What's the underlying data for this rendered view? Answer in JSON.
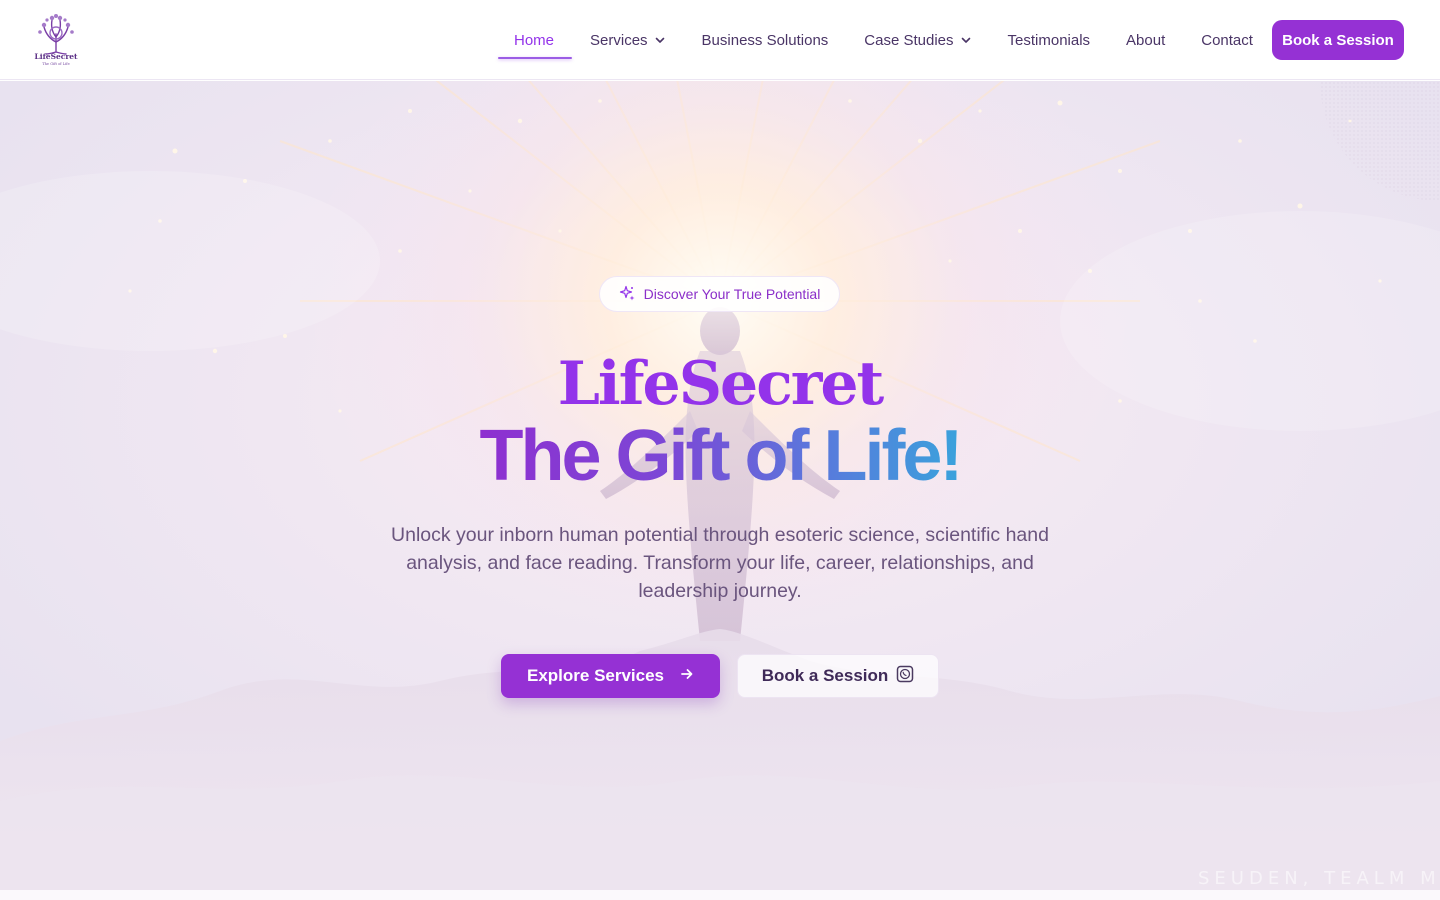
{
  "brand": {
    "logo_icon": "tree-of-life-icon",
    "logo_wordmark": "LifeSecret",
    "logo_tagline": "The Gift of Life"
  },
  "nav": {
    "items": [
      {
        "label": "Home",
        "active": true
      },
      {
        "label": "Services",
        "dropdown": true
      },
      {
        "label": "Business Solutions"
      },
      {
        "label": "Case Studies",
        "dropdown": true
      },
      {
        "label": "Testimonials"
      },
      {
        "label": "About"
      },
      {
        "label": "Contact"
      }
    ],
    "cta_label": "Book a Session"
  },
  "hero": {
    "badge_icon": "sparkles-icon",
    "badge_text": "Discover Your True Potential",
    "title_line1": "LifeSecret",
    "title_line2": "The Gift of Life!",
    "subtitle": "Unlock your inborn human potential through esoteric science, scientific hand analysis, and face reading. Transform your life, career, relationships, and leadership journey.",
    "primary_button": {
      "label": "Explore Services",
      "icon": "arrow-right-icon"
    },
    "secondary_button": {
      "label": "Book a Session",
      "icon": "whatsapp-icon"
    },
    "watermark": "SEUDEN, TEALM MI"
  },
  "colors": {
    "accent": "#9333ea",
    "button": "#9531d4",
    "text": "#4a3566",
    "gradient_end": "#3aa2dc"
  }
}
